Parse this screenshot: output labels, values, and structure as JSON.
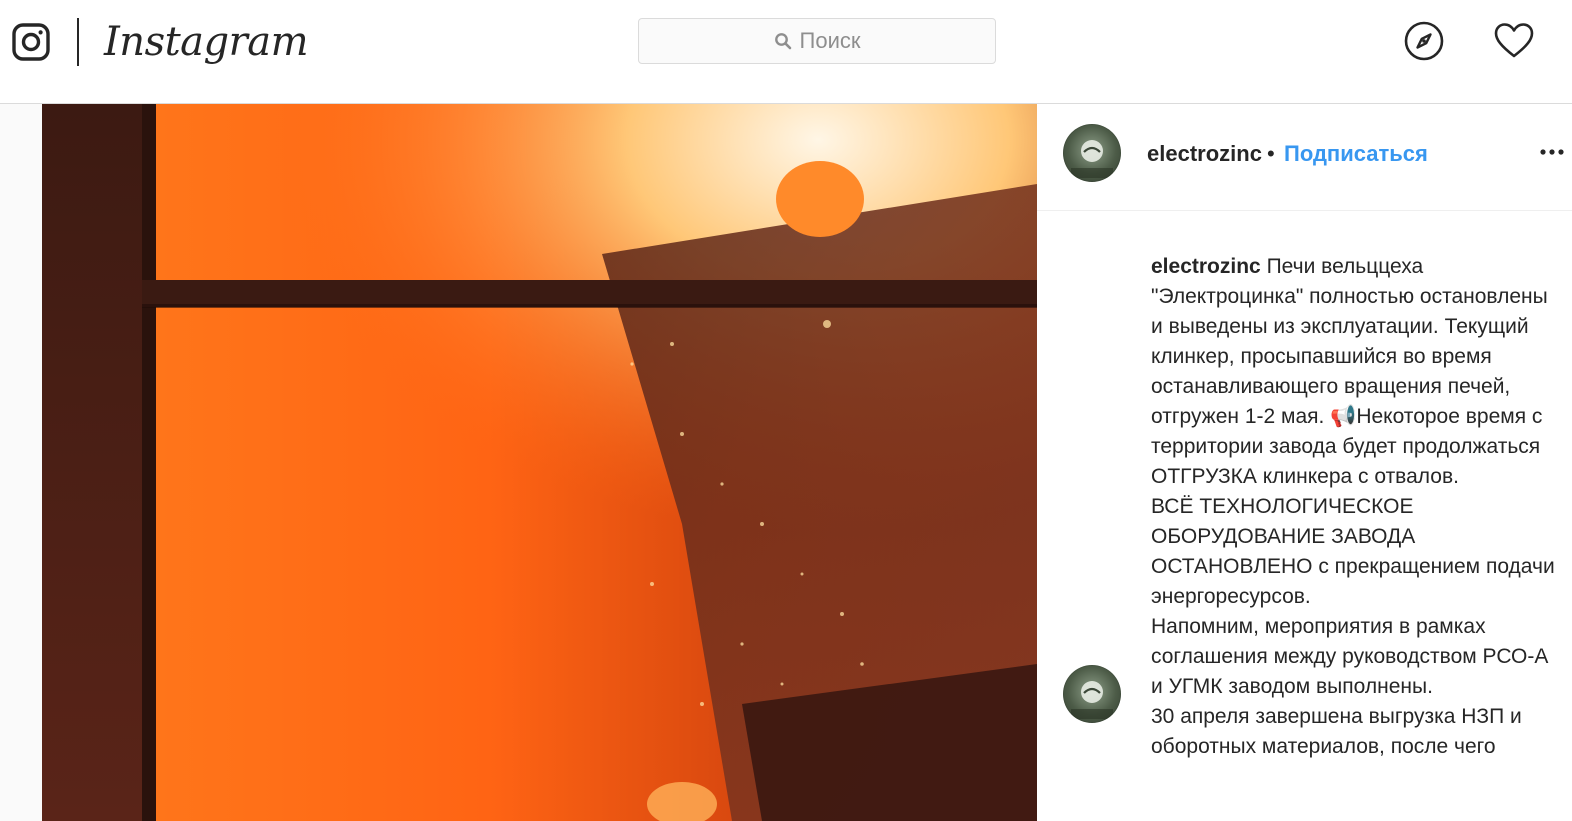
{
  "header": {
    "logo_text": "Instagram",
    "search": {
      "placeholder": "Поиск"
    }
  },
  "icons": {
    "logo": "instagram-glyph-icon",
    "search": "search-icon",
    "explore": "compass-icon",
    "activity": "heart-icon",
    "more": "more-options-icon"
  },
  "post": {
    "username": "electrozinc",
    "separator": "•",
    "follow_label": "Подписаться",
    "caption": {
      "username": "electrozinc",
      "text": "Печи вельццеха \"Электроцинка\" полностью остановлены и выведены из эксплуатации. Текущий клинкер, просыпавшийся во время останавливающего вращения печей, отгружен 1-2 мая. 📢Некоторое время с территории завода будет продолжаться ОТГРУЗКА клинкера с отвалов.\nВСЁ ТЕХНОЛОГИЧЕСКОЕ ОБОРУДОВАНИЕ ЗАВОДА ОСТАНОВЛЕНО с прекращением подачи энергоресурсов.\nНапомним, мероприятия в рамках соглашения между руководством РСО-А и УГМК заводом выполнены.\n30 апреля завершена выгрузка НЗП и оборотных материалов, после чего"
    }
  },
  "colors": {
    "link": "#3897f0",
    "text": "#262626",
    "border": "#dbdbdb"
  }
}
